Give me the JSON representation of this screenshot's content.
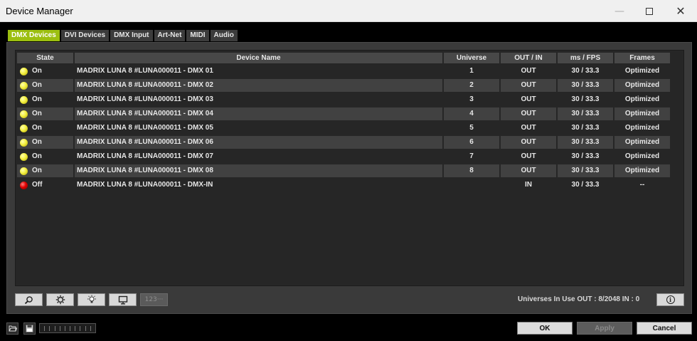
{
  "window": {
    "title": "Device Manager"
  },
  "tabs": [
    {
      "label": "DMX Devices",
      "active": true
    },
    {
      "label": "DVI Devices",
      "active": false
    },
    {
      "label": "DMX Input",
      "active": false
    },
    {
      "label": "Art-Net",
      "active": false
    },
    {
      "label": "MIDI",
      "active": false
    },
    {
      "label": "Audio",
      "active": false
    }
  ],
  "table": {
    "columns": [
      "State",
      "Device Name",
      "Universe",
      "OUT / IN",
      "ms / FPS",
      "Frames"
    ],
    "rows": [
      {
        "led": "on",
        "state": "On",
        "name": "MADRIX LUNA 8 #LUNA000011 - DMX 01",
        "universe": "1",
        "out_in": "OUT",
        "fps": "30 / 33.3",
        "frames": "Optimized"
      },
      {
        "led": "on",
        "state": "On",
        "name": "MADRIX LUNA 8 #LUNA000011 - DMX 02",
        "universe": "2",
        "out_in": "OUT",
        "fps": "30 / 33.3",
        "frames": "Optimized"
      },
      {
        "led": "on",
        "state": "On",
        "name": "MADRIX LUNA 8 #LUNA000011 - DMX 03",
        "universe": "3",
        "out_in": "OUT",
        "fps": "30 / 33.3",
        "frames": "Optimized"
      },
      {
        "led": "on",
        "state": "On",
        "name": "MADRIX LUNA 8 #LUNA000011 - DMX 04",
        "universe": "4",
        "out_in": "OUT",
        "fps": "30 / 33.3",
        "frames": "Optimized"
      },
      {
        "led": "on",
        "state": "On",
        "name": "MADRIX LUNA 8 #LUNA000011 - DMX 05",
        "universe": "5",
        "out_in": "OUT",
        "fps": "30 / 33.3",
        "frames": "Optimized"
      },
      {
        "led": "on",
        "state": "On",
        "name": "MADRIX LUNA 8 #LUNA000011 - DMX 06",
        "universe": "6",
        "out_in": "OUT",
        "fps": "30 / 33.3",
        "frames": "Optimized"
      },
      {
        "led": "on",
        "state": "On",
        "name": "MADRIX LUNA 8 #LUNA000011 - DMX 07",
        "universe": "7",
        "out_in": "OUT",
        "fps": "30 / 33.3",
        "frames": "Optimized"
      },
      {
        "led": "on",
        "state": "On",
        "name": "MADRIX LUNA 8 #LUNA000011 - DMX 08",
        "universe": "8",
        "out_in": "OUT",
        "fps": "30 / 33.3",
        "frames": "Optimized"
      },
      {
        "led": "off",
        "state": "Off",
        "name": "MADRIX LUNA 8 #LUNA000011 - DMX-IN",
        "universe": "",
        "out_in": "IN",
        "fps": "30 / 33.3",
        "frames": "--"
      }
    ]
  },
  "toolbar": {
    "search_icon": "search-icon",
    "settings_icon": "gear-icon",
    "identify_icon": "light-bulb-icon",
    "display_icon": "monitor-icon",
    "numbers_label": "123···"
  },
  "status": {
    "universes_text": "Universes In Use OUT : 8/2048  IN : 0",
    "info_glyph": "i"
  },
  "footer": {
    "ok_label": "OK",
    "apply_label": "Apply",
    "cancel_label": "Cancel"
  },
  "colors": {
    "active_tab": "#9cbf10",
    "led_on": "#f4f040",
    "led_off": "#e00000"
  }
}
